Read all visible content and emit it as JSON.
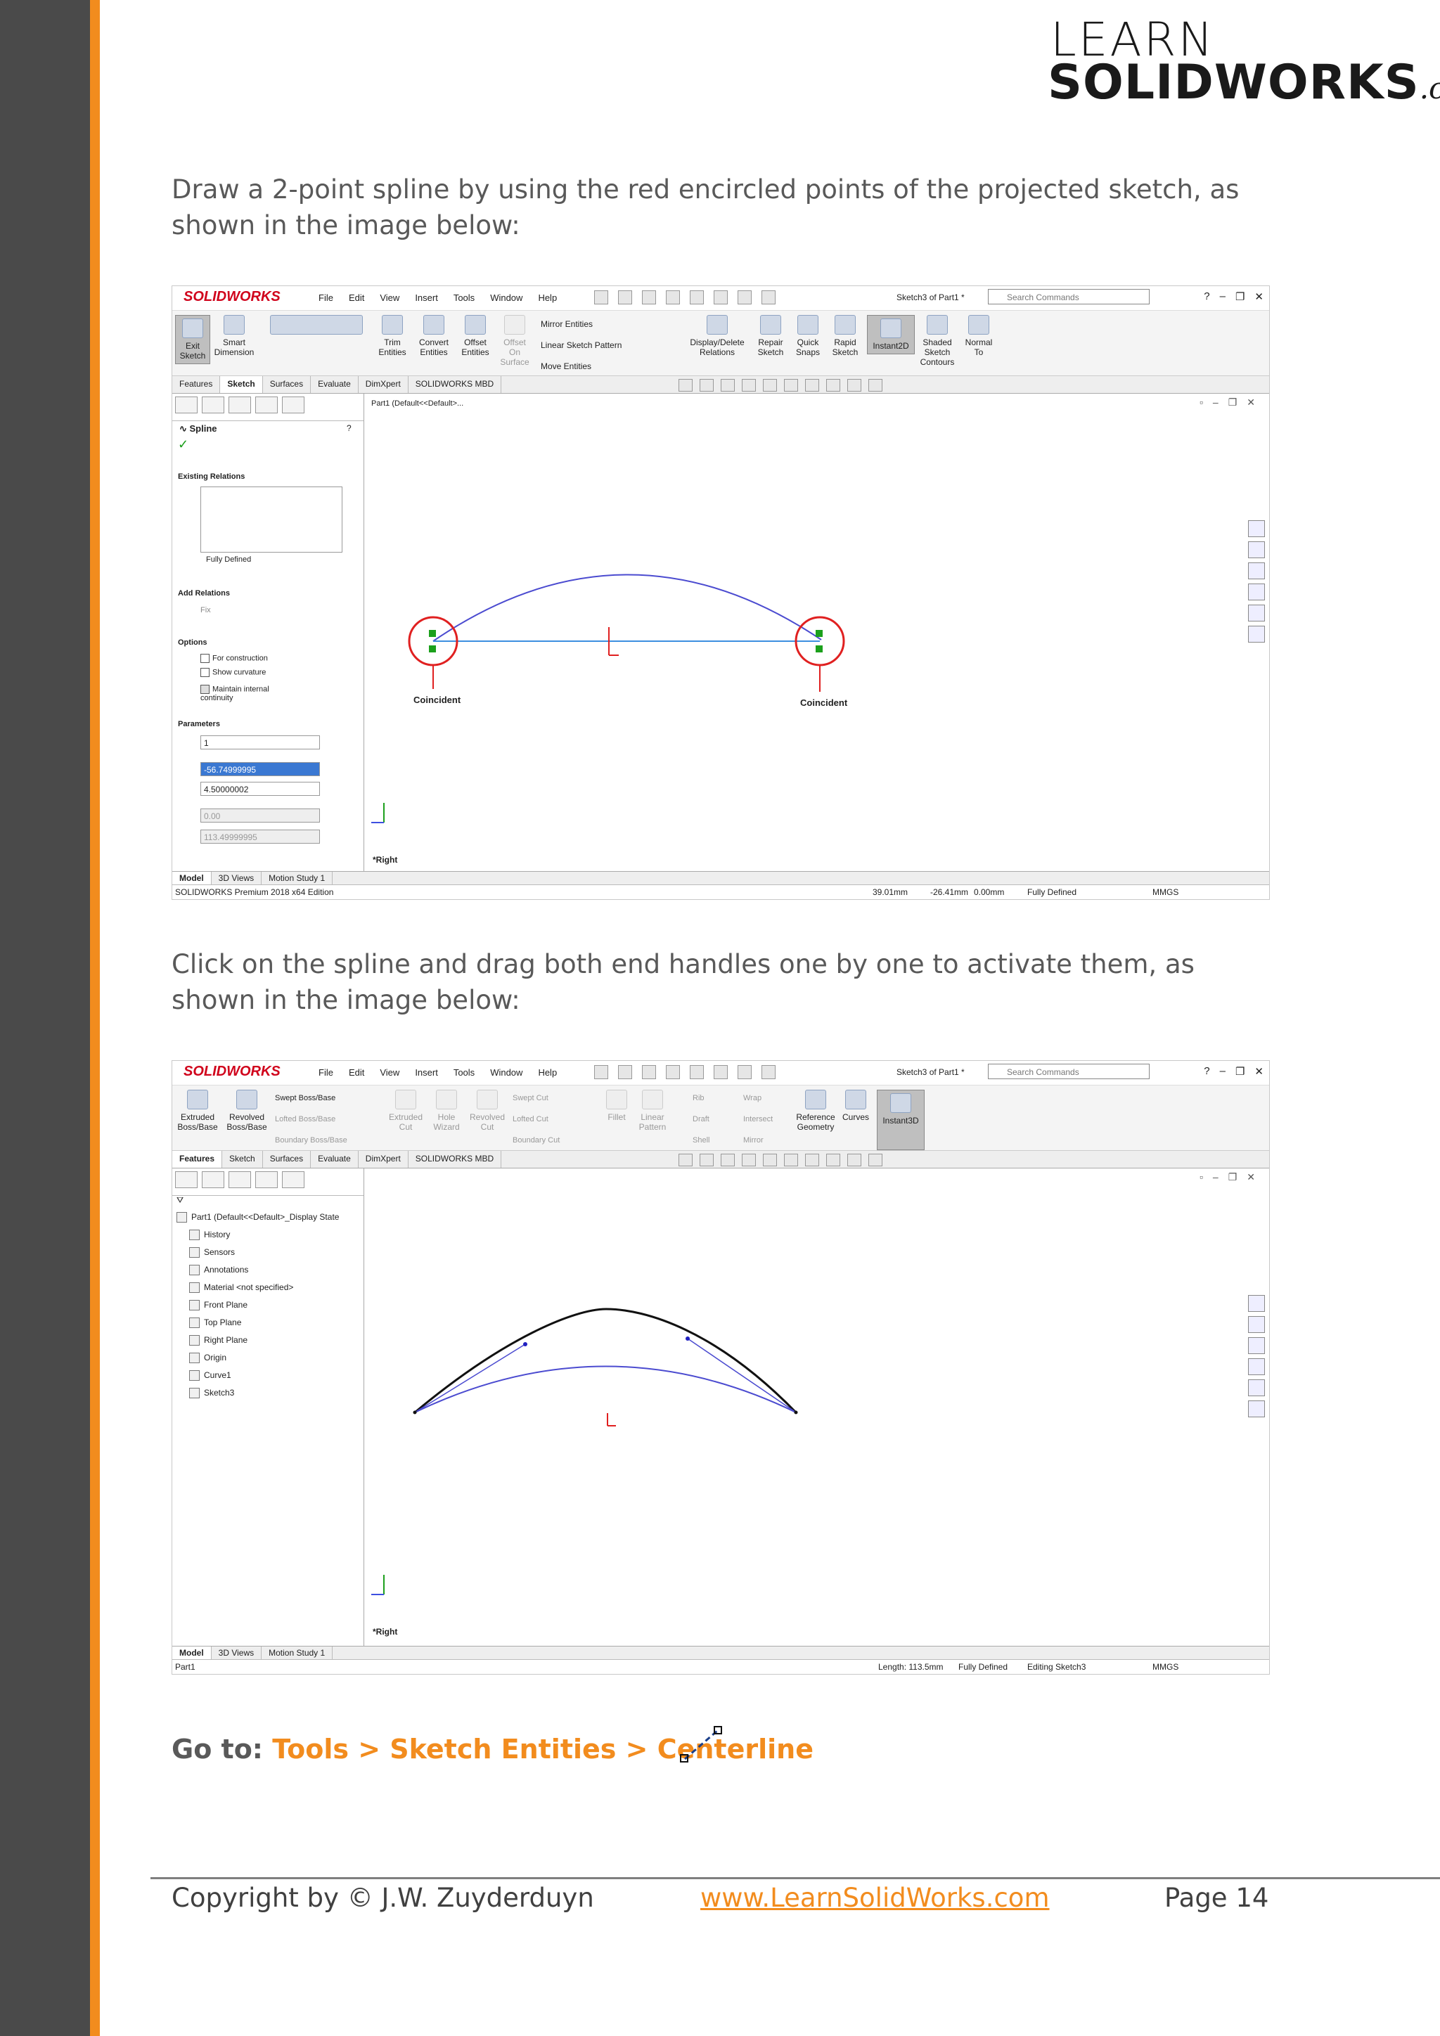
{
  "logo": {
    "line1": "LEARN",
    "line2": "SOLIDWORKS",
    "suffix": ".com"
  },
  "intro1": "Draw a 2-point spline by using the red encircled points of the projected sketch, as shown in the image below:",
  "intro2": "Click on the spline and drag both end handles one by one to activate them, as shown in the image below:",
  "goto": {
    "prefix": "Go to:",
    "path": "Tools > Sketch Entities > Centerline"
  },
  "footer": {
    "copyright": "Copyright by © J.W. Zuyderduyn",
    "link": "www.LearnSolidWorks.com",
    "page": "Page 14"
  },
  "common": {
    "app_logo": "SOLIDWORKS",
    "menu": [
      "File",
      "Edit",
      "View",
      "Insert",
      "Tools",
      "Window",
      "Help"
    ],
    "doc_title": "Sketch3 of Part1 *",
    "search_placeholder": "Search Commands",
    "bottom_tabs": [
      "Model",
      "3D Views",
      "Motion Study 1"
    ],
    "view_label": "*Right",
    "units": "MMGS"
  },
  "shot1": {
    "ribbon": [
      {
        "label": "Exit\nSketch"
      },
      {
        "label": "Smart\nDimension"
      },
      {
        "label": "Trim\nEntities"
      },
      {
        "label": "Convert\nEntities"
      },
      {
        "label": "Offset\nEntities"
      },
      {
        "label": "Offset\nOn\nSurface"
      },
      {
        "label": "Mirror Entities"
      },
      {
        "label": "Linear Sketch Pattern"
      },
      {
        "label": "Move Entities"
      },
      {
        "label": "Display/Delete\nRelations"
      },
      {
        "label": "Repair\nSketch"
      },
      {
        "label": "Quick\nSnaps"
      },
      {
        "label": "Rapid\nSketch"
      },
      {
        "label": "Instant2D"
      },
      {
        "label": "Shaded\nSketch\nContours"
      },
      {
        "label": "Normal\nTo"
      }
    ],
    "tabs": [
      "Features",
      "Sketch",
      "Surfaces",
      "Evaluate",
      "DimXpert",
      "SOLIDWORKS MBD"
    ],
    "tree_root": "Part1  (Default<<Default>...",
    "panel": {
      "title": "Spline",
      "existing_relations": "Existing Relations",
      "fully_defined": "Fully Defined",
      "add_relations": "Add Relations",
      "fix": "Fix",
      "options": "Options",
      "opt1": "For construction",
      "opt2": "Show curvature",
      "opt3": "Maintain internal continuity",
      "parameters": "Parameters",
      "p1": "1",
      "p2": "-56.74999995",
      "p3": "4.50000002",
      "p4": "0.00",
      "p5": "113.49999995"
    },
    "label_left": "Coincident",
    "label_right": "Coincident",
    "status": {
      "edition": "SOLIDWORKS Premium 2018 x64 Edition",
      "x": "39.01mm",
      "y": "-26.41mm",
      "z": "0.00mm",
      "state": "Fully Defined"
    }
  },
  "shot2": {
    "ribbon": [
      {
        "label": "Extruded\nBoss/Base"
      },
      {
        "label": "Revolved\nBoss/Base"
      },
      {
        "label": "Swept Boss/Base"
      },
      {
        "label": "Lofted Boss/Base"
      },
      {
        "label": "Boundary Boss/Base"
      },
      {
        "label": "Extruded\nCut"
      },
      {
        "label": "Hole\nWizard"
      },
      {
        "label": "Revolved\nCut"
      },
      {
        "label": "Swept Cut"
      },
      {
        "label": "Lofted Cut"
      },
      {
        "label": "Boundary Cut"
      },
      {
        "label": "Fillet"
      },
      {
        "label": "Linear\nPattern"
      },
      {
        "label": "Rib"
      },
      {
        "label": "Draft"
      },
      {
        "label": "Shell"
      },
      {
        "label": "Wrap"
      },
      {
        "label": "Intersect"
      },
      {
        "label": "Mirror"
      },
      {
        "label": "Reference\nGeometry"
      },
      {
        "label": "Curves"
      },
      {
        "label": "Instant3D"
      }
    ],
    "tabs": [
      "Features",
      "Sketch",
      "Surfaces",
      "Evaluate",
      "DimXpert",
      "SOLIDWORKS MBD"
    ],
    "tree": [
      "Part1  (Default<<Default>_Display State",
      "History",
      "Sensors",
      "Annotations",
      "Material <not specified>",
      "Front Plane",
      "Top Plane",
      "Right Plane",
      "Origin",
      "Curve1",
      "Sketch3"
    ],
    "status": {
      "name": "Part1",
      "length": "Length: 113.5mm",
      "state": "Fully Defined",
      "editing": "Editing Sketch3"
    }
  }
}
